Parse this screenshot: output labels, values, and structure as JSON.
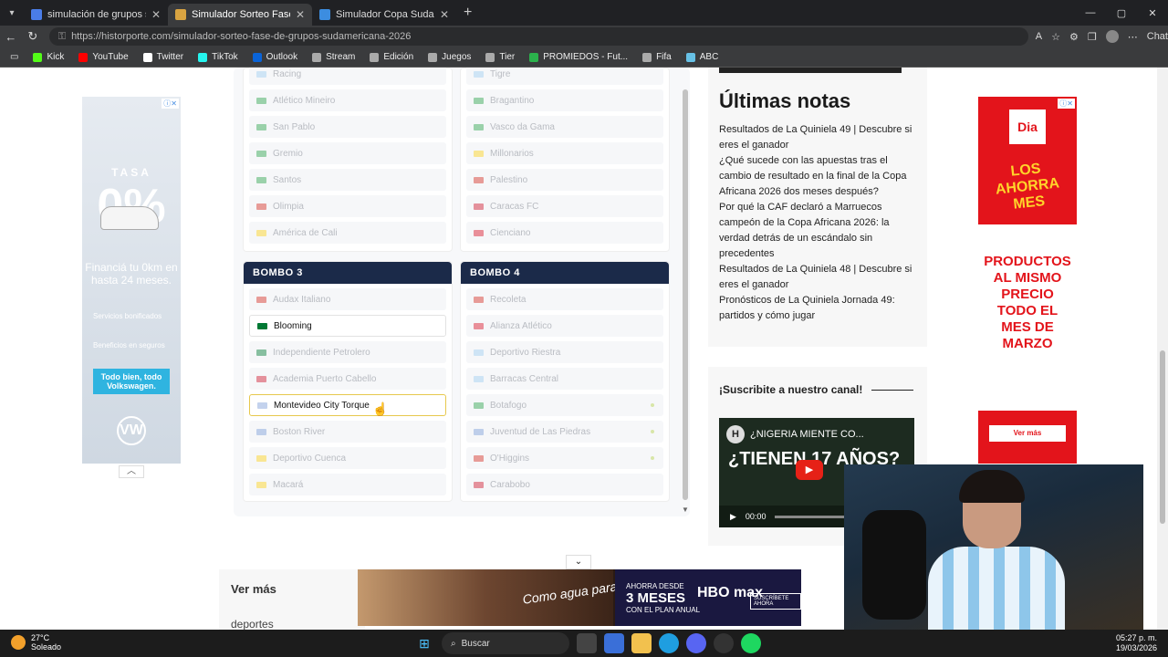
{
  "browser": {
    "tabs": [
      {
        "label": "simulación de grupos sudamerica",
        "color": "#4a7de8",
        "active": false
      },
      {
        "label": "Simulador Sorteo Fase de Grupos",
        "color": "#d9a441",
        "active": true
      },
      {
        "label": "Simulador Copa Sudamericana - C",
        "color": "#3c8de0",
        "active": false
      }
    ],
    "url": "https://historporte.com/simulador-sorteo-fase-de-grupos-sudamericana-2026",
    "chat_label": "Chat",
    "bookmarks": [
      {
        "label": "Kick",
        "color": "#53fc18"
      },
      {
        "label": "YouTube",
        "color": "#ff0000"
      },
      {
        "label": "Twitter",
        "color": "#ffffff"
      },
      {
        "label": "TikTok",
        "color": "#25f4ee"
      },
      {
        "label": "Outlook",
        "color": "#0a64d8"
      },
      {
        "label": "Stream",
        "color": "#aaaaaa"
      },
      {
        "label": "Edición",
        "color": "#aaaaaa"
      },
      {
        "label": "Juegos",
        "color": "#aaaaaa"
      },
      {
        "label": "Tier",
        "color": "#aaaaaa"
      },
      {
        "label": "PROMIEDOS - Fut...",
        "color": "#2bb24c"
      },
      {
        "label": "Fifa",
        "color": "#aaaaaa"
      },
      {
        "label": "ABC",
        "color": "#67c1e6"
      }
    ]
  },
  "simulator": {
    "pot1_rest": [
      {
        "name": "Racing",
        "flag": "#9ecbf0"
      },
      {
        "name": "Atlético Mineiro",
        "flag": "#2aa14a"
      },
      {
        "name": "San Pablo",
        "flag": "#2aa14a"
      },
      {
        "name": "Gremio",
        "flag": "#2aa14a"
      },
      {
        "name": "Santos",
        "flag": "#2aa14a"
      },
      {
        "name": "Olimpia",
        "flag": "#d52b1e"
      },
      {
        "name": "América de Cali",
        "flag": "#fcd116"
      }
    ],
    "pot2_rest": [
      {
        "name": "Tigre",
        "flag": "#9ecbf0"
      },
      {
        "name": "Bragantino",
        "flag": "#2aa14a"
      },
      {
        "name": "Vasco da Gama",
        "flag": "#2aa14a"
      },
      {
        "name": "Millonarios",
        "flag": "#fcd116"
      },
      {
        "name": "Palestino",
        "flag": "#d52b1e"
      },
      {
        "name": "Caracas FC",
        "flag": "#cf142b"
      },
      {
        "name": "Cienciano",
        "flag": "#d91023"
      }
    ],
    "pot3": {
      "title": "BOMBO 3",
      "teams": [
        {
          "name": "Audax Italiano",
          "flag": "#d52b1e",
          "state": "used"
        },
        {
          "name": "Blooming",
          "flag": "#007934",
          "state": "selected"
        },
        {
          "name": "Independiente Petrolero",
          "flag": "#007934",
          "state": "used"
        },
        {
          "name": "Academia Puerto Cabello",
          "flag": "#cf142b",
          "state": "used"
        },
        {
          "name": "Montevideo City Torque",
          "flag": "#7b9bd6",
          "state": "hover"
        },
        {
          "name": "Boston River",
          "flag": "#7b9bd6",
          "state": "used"
        },
        {
          "name": "Deportivo Cuenca",
          "flag": "#fcd116",
          "state": "used"
        },
        {
          "name": "Macará",
          "flag": "#fcd116",
          "state": "used"
        }
      ]
    },
    "pot4": {
      "title": "BOMBO 4",
      "teams": [
        {
          "name": "Recoleta",
          "flag": "#d52b1e",
          "state": "used"
        },
        {
          "name": "Alianza Atlético",
          "flag": "#d91023",
          "state": "used"
        },
        {
          "name": "Deportivo Riestra",
          "flag": "#9ecbf0",
          "state": "used"
        },
        {
          "name": "Barracas Central",
          "flag": "#9ecbf0",
          "state": "used"
        },
        {
          "name": "Botafogo",
          "flag": "#2aa14a",
          "state": "used",
          "dot": true
        },
        {
          "name": "Juventud de Las Piedras",
          "flag": "#7b9bd6",
          "state": "used",
          "dot": true
        },
        {
          "name": "O'Higgins",
          "flag": "#d52b1e",
          "state": "used",
          "dot": true
        },
        {
          "name": "Carabobo",
          "flag": "#cf142b",
          "state": "used"
        }
      ]
    }
  },
  "notes": {
    "title": "Últimas notas",
    "items": [
      "Resultados de La Quiniela 49 | Descubre si eres el ganador",
      "¿Qué sucede con las apuestas tras el cambio de resultado en la final de la Copa Africana 2026 dos meses después?",
      "Por qué la CAF declaró a Marruecos campeón de la Copa Africana 2026: la verdad detrás de un escándalo sin precedentes",
      "Resultados de La Quiniela 48 | Descubre si eres el ganador",
      "Pronósticos de La Quiniela Jornada 49: partidos y cómo jugar"
    ]
  },
  "subscribe": {
    "title": "¡Suscribite a nuestro canal!",
    "video_title": "¿NIGERIA MIENTE CO...",
    "video_text": "¿TIENEN 17 AÑOS?",
    "video_time": "00:00"
  },
  "ad_left": {
    "tasa": "TASA",
    "pct": "0%",
    "fin": "Financiá tu 0km en hasta 24 meses.",
    "s1": "Servicios bonificados",
    "s2": "Beneficios en seguros",
    "cta": "Todo bien, todo Volkswagen.",
    "logo": "VW"
  },
  "ad_right": {
    "brand": "Dia",
    "slogan": "LOS AHORRA MES",
    "prod": "PRODUCTOS AL MISMO PRECIO TODO EL MES DE MARZO",
    "cta": "Ver más"
  },
  "ver_mas": {
    "title": "Ver más",
    "sub": "deportes"
  },
  "bottom_ad": {
    "como": "Como agua para Chocolate",
    "a1": "AHORRA DESDE",
    "a2": "3 MESES",
    "a3": "CON EL PLAN ANUAL",
    "hbo": "HBO max",
    "sus": "SUSCRÍBETE AHORA"
  },
  "taskbar": {
    "temp": "27°C",
    "weather": "Soleado",
    "search": "Buscar",
    "time": "05:27 p. m.",
    "date": "19/03/2026"
  }
}
